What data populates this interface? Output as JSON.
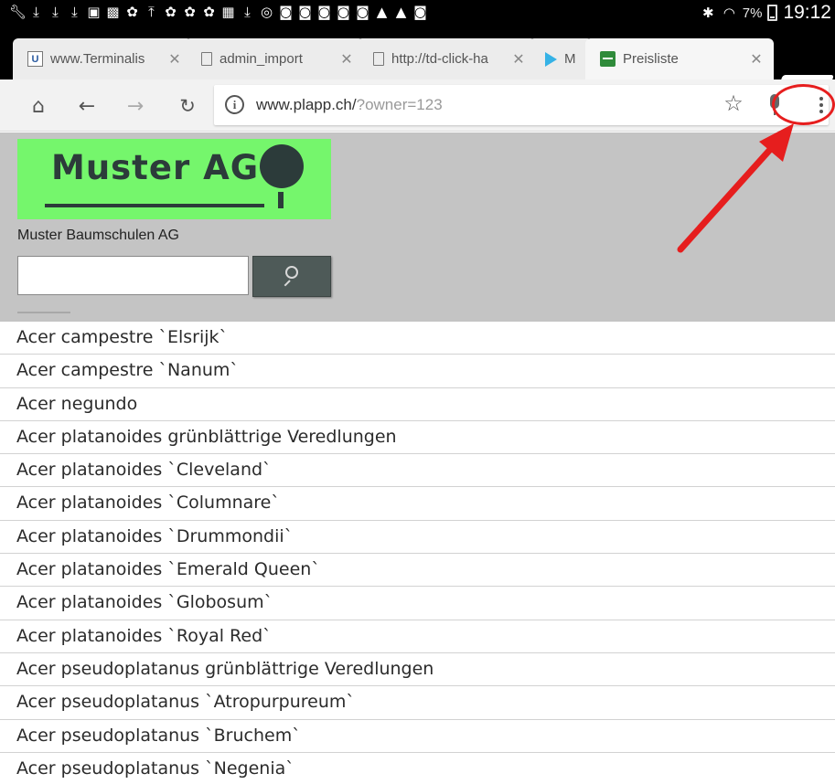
{
  "status_bar": {
    "icons": [
      "wrench-icon",
      "download-icon",
      "download-icon",
      "download-icon",
      "screen-icon",
      "app-icon",
      "flower-icon",
      "upload-icon",
      "flower-icon",
      "flower-icon",
      "flower-icon",
      "photo-icon",
      "download-icon",
      "sync-icon",
      "bag-icon",
      "bag-icon",
      "bag-icon",
      "bag-icon",
      "bag-icon",
      "warning-icon",
      "warning-icon",
      "bag-icon"
    ],
    "battery": "7%",
    "time": "19:12"
  },
  "tabs": [
    {
      "title": "www.Terminalis",
      "favicon": "U",
      "active": false
    },
    {
      "title": "admin_import",
      "active": false
    },
    {
      "title": "http://td-click-ha",
      "active": false
    },
    {
      "title": "M",
      "active": false
    },
    {
      "title": "Preisliste",
      "active": true
    }
  ],
  "toolbar": {
    "url_host": "www.plapp.ch/",
    "url_query": "?owner=123"
  },
  "page": {
    "logo_text": "Muster AG",
    "company_name": "Muster Baumschulen AG",
    "search_value": ""
  },
  "plants": [
    "Acer campestre `Elsrijk`",
    "Acer campestre `Nanum`",
    "Acer negundo",
    "Acer platanoides grünblättrige Veredlungen",
    "Acer platanoides `Cleveland`",
    "Acer platanoides `Columnare`",
    "Acer platanoides `Drummondii`",
    "Acer platanoides `Emerald Queen`",
    "Acer platanoides `Globosum`",
    "Acer platanoides `Royal Red`",
    "Acer pseudoplatanus grünblättrige Veredlungen",
    "Acer pseudoplatanus `Atropurpureum`",
    "Acer pseudoplatanus `Bruchem`",
    "Acer pseudoplatanus `Negenia`"
  ],
  "colors": {
    "logo_background": "#75f66c",
    "header_background": "#c4c4c4",
    "search_button": "#4e5a58",
    "annotation": "#e61e1e"
  }
}
